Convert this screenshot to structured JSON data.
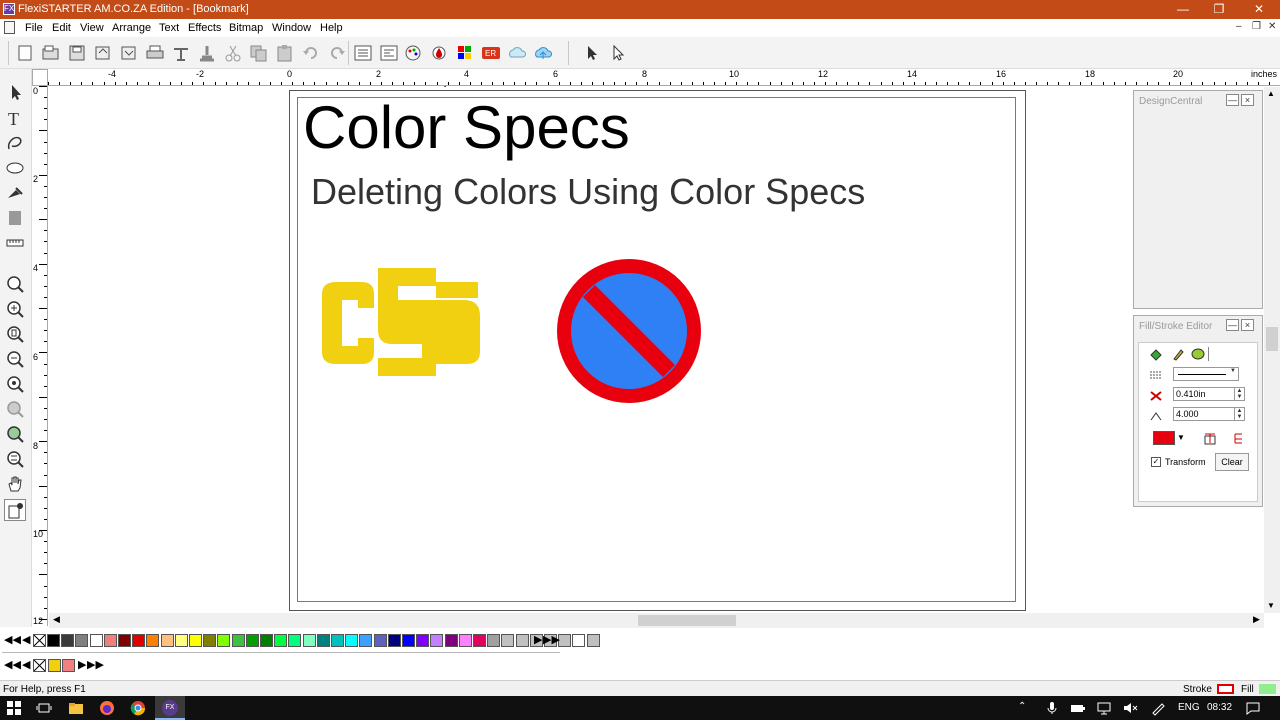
{
  "window": {
    "title": "FlexiSTARTER AM.CO.ZA Edition - [Bookmark]",
    "app_icon": "FX"
  },
  "menu": {
    "items": [
      "File",
      "Edit",
      "View",
      "Arrange",
      "Text",
      "Effects",
      "Bitmap",
      "Window",
      "Help"
    ]
  },
  "ruler": {
    "unit": "inches",
    "h_labels": [
      "-4",
      "-2",
      "0",
      "2",
      "4",
      "6",
      "8",
      "10",
      "12",
      "14",
      "16",
      "18",
      "20"
    ],
    "v_labels": [
      "0",
      "2",
      "4",
      "6",
      "8",
      "10",
      "12"
    ]
  },
  "document": {
    "title": "Color Specs",
    "subtitle": "Deleting Colors Using Color Specs",
    "logo_letters": "cS",
    "logo_color": "#f0d011",
    "no_sign_ring_color": "#e8000f",
    "no_sign_fill_color": "#2f7ff5"
  },
  "panels": {
    "design_central": {
      "title": "DesignCentral"
    },
    "fill_stroke": {
      "title": "Fill/Stroke Editor",
      "width_value": "0.410in",
      "miter_value": "4.000",
      "stroke_color": "#e8000f",
      "transform_label": "Transform",
      "transform_checked": true,
      "clear_label": "Clear"
    }
  },
  "palette": {
    "colors": [
      "#000000",
      "#3a3a3a",
      "#808080",
      "#ffffff",
      "#f08080",
      "#800000",
      "#e00000",
      "#ff8000",
      "#ffc080",
      "#ffff80",
      "#ffff00",
      "#808000",
      "#80ff00",
      "#40c040",
      "#00a000",
      "#008000",
      "#00ff40",
      "#00ff80",
      "#80ffc0",
      "#008080",
      "#00c0c0",
      "#00ffff",
      "#40a0ff",
      "#6060c0",
      "#000080",
      "#0000ff",
      "#8000ff",
      "#c080ff",
      "#800080",
      "#ff80ff",
      "#e00060",
      "#a0a0a0",
      "#c0c0c0",
      "#c0c0c0",
      "#c0c0c0",
      "#c0c0c0",
      "#c0c0c0",
      "#ffffff",
      "#c0c0c0"
    ],
    "doc_colors": [
      "#f0d011",
      "#f08080"
    ]
  },
  "status": {
    "help": "For Help, press F1",
    "stroke_label": "Stroke",
    "fill_label": "Fill",
    "stroke_color": "#e00000",
    "fill_color": "#90ee90"
  },
  "taskbar": {
    "lang": "ENG",
    "time": "08:32"
  }
}
